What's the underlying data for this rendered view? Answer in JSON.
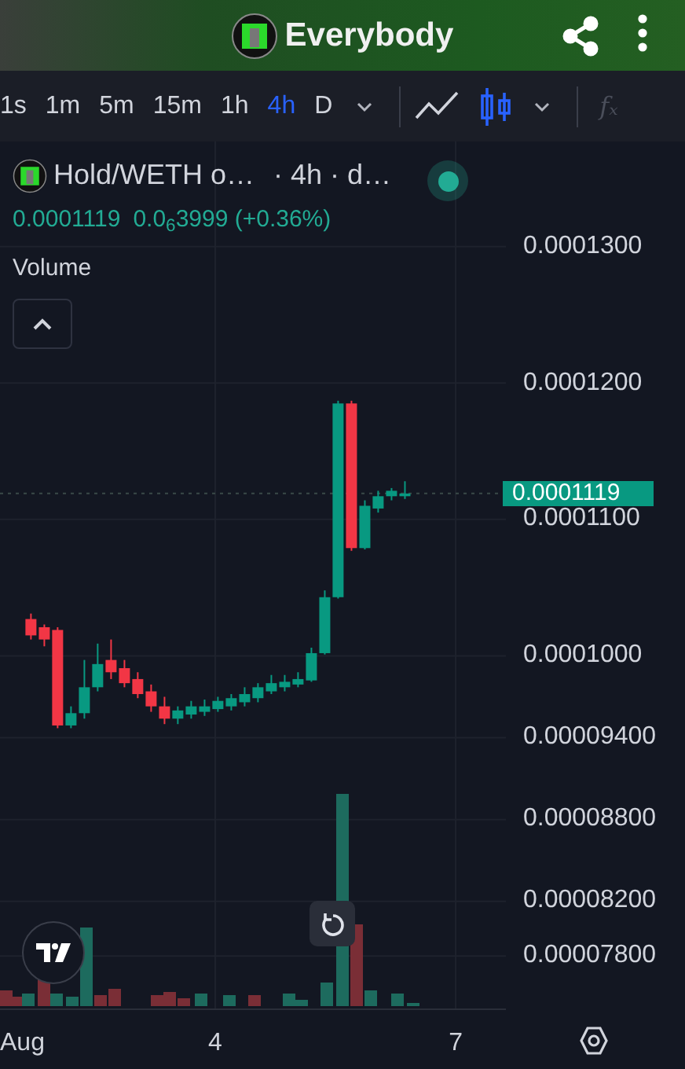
{
  "header": {
    "title": "Everybody"
  },
  "intervals": [
    {
      "label": "1s",
      "selected": false
    },
    {
      "label": "1m",
      "selected": false
    },
    {
      "label": "5m",
      "selected": false
    },
    {
      "label": "15m",
      "selected": false
    },
    {
      "label": "1h",
      "selected": false
    },
    {
      "label": "4h",
      "selected": true
    },
    {
      "label": "D",
      "selected": false
    }
  ],
  "chart_types": [
    {
      "kind": "line",
      "selected": false
    },
    {
      "kind": "candles",
      "selected": true
    }
  ],
  "indicators_button": {
    "label": "fₓ",
    "disabled": true
  },
  "legend": {
    "symbol": "Hold/WETH o…",
    "details": "· 4h · d…",
    "live": true,
    "price": "0.0001119",
    "change": "0.0$_{6}$3999 (+0.36%)",
    "volume_label": "Volume",
    "collapsed": false
  },
  "chart": {
    "last_price": "0.0001119",
    "chart_data": {
      "type": "candlestick",
      "xlim": [
        1.314,
        7.627
      ],
      "ylim": [
        7.41e-05,
        0.0001377
      ],
      "grid": true,
      "ref_lines": [
        {
          "axis": "y",
          "value": 0.0001119
        }
      ],
      "x": [
        1.7,
        1.867,
        2.033,
        2.2,
        2.367,
        2.533,
        2.7,
        2.867,
        3.033,
        3.2,
        3.367,
        3.533,
        3.7,
        3.867,
        4.033,
        4.2,
        4.367,
        4.533,
        4.7,
        4.867,
        5.033,
        5.2,
        5.367,
        5.533,
        5.7,
        5.867,
        6.033,
        6.2,
        6.367
      ],
      "ohlc": [
        [
          0.0001027,
          0.0001031,
          0.0001012,
          0.0001015
        ],
        [
          0.0001021,
          0.0001023,
          0.0001007,
          0.0001012
        ],
        [
          0.0001019,
          0.0001021,
          9.47e-05,
          9.49e-05
        ],
        [
          9.49e-05,
          9.63e-05,
          9.47e-05,
          9.58e-05
        ],
        [
          9.58e-05,
          9.97e-05,
          9.54e-05,
          9.77e-05
        ],
        [
          9.77e-05,
          0.0001009,
          9.74e-05,
          9.94e-05
        ],
        [
          9.97e-05,
          0.0001012,
          9.83e-05,
          9.88e-05
        ],
        [
          9.91e-05,
          9.97e-05,
          9.77e-05,
          9.8e-05
        ],
        [
          9.83e-05,
          9.88e-05,
          9.69e-05,
          9.72e-05
        ],
        [
          9.74e-05,
          9.79e-05,
          9.59e-05,
          9.63e-05
        ],
        [
          9.63e-05,
          9.7e-05,
          9.5e-05,
          9.54e-05
        ],
        [
          9.54e-05,
          9.63e-05,
          9.5e-05,
          9.6e-05
        ],
        [
          9.57e-05,
          9.67e-05,
          9.54e-05,
          9.63e-05
        ],
        [
          9.59e-05,
          9.68e-05,
          9.56e-05,
          9.63e-05
        ],
        [
          9.61e-05,
          9.7e-05,
          9.59e-05,
          9.67e-05
        ],
        [
          9.63e-05,
          9.72e-05,
          9.6e-05,
          9.69e-05
        ],
        [
          9.66e-05,
          9.77e-05,
          9.63e-05,
          9.72e-05
        ],
        [
          9.69e-05,
          9.8e-05,
          9.66e-05,
          9.77e-05
        ],
        [
          9.74e-05,
          9.86e-05,
          9.72e-05,
          9.8e-05
        ],
        [
          9.77e-05,
          9.86e-05,
          9.74e-05,
          9.81e-05
        ],
        [
          9.79e-05,
          9.88e-05,
          9.77e-05,
          9.83e-05
        ],
        [
          9.82e-05,
          0.0001006,
          9.81e-05,
          0.0001002
        ],
        [
          0.0001002,
          0.0001048,
          0.0001001,
          0.0001043
        ],
        [
          0.0001043,
          0.0001187,
          0.0001042,
          0.0001185
        ],
        [
          0.0001185,
          0.0001187,
          0.0001077,
          0.0001079
        ],
        [
          0.0001079,
          0.0001114,
          0.0001078,
          0.000111
        ],
        [
          0.0001108,
          0.0001121,
          0.0001105,
          0.0001117
        ],
        [
          0.0001117,
          0.0001123,
          0.0001114,
          0.0001121
        ],
        [
          0.0001117,
          0.0001128,
          0.0001115,
          0.0001119
        ]
      ],
      "yticks": [
        {
          "value": 0.00013,
          "label": "0.0001300"
        },
        {
          "value": 0.00012,
          "label": "0.0001200"
        },
        {
          "value": 0.00011,
          "label": "0.0001100"
        },
        {
          "value": 0.0001,
          "label": "0.0001000"
        },
        {
          "value": 9.4e-05,
          "label": "0.00009400"
        },
        {
          "value": 8.8e-05,
          "label": "0.00008800"
        },
        {
          "value": 8.2e-05,
          "label": "0.00008200"
        },
        {
          "value": 7.8e-05,
          "label": "0.00007800"
        }
      ],
      "xticks": [
        {
          "value": 4,
          "label": "4"
        },
        {
          "value": 7,
          "label": "7"
        }
      ]
    },
    "month_label": "Aug"
  }
}
